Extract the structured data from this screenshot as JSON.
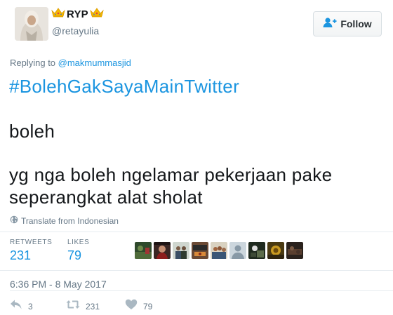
{
  "author": {
    "display_name": "RYP",
    "handle": "@retayulia",
    "avatar_icon": "profile-photo"
  },
  "follow_button": {
    "label": "Follow",
    "icon": "follow-person-icon"
  },
  "replying": {
    "prefix": "Replying to ",
    "mention": "@makmummasjid"
  },
  "tweet": {
    "hashtag": "#BolehGakSayaMainTwitter",
    "line_boleh": "boleh",
    "line_yg": "yg nga boleh ngelamar pekerjaan pake",
    "line_seperangkat": "seperangkat alat sholat"
  },
  "translate": {
    "label": "Translate from Indonesian",
    "icon": "globe-icon"
  },
  "stats": {
    "retweets_label": "RETWEETS",
    "retweets_value": "231",
    "likes_label": "LIKES",
    "likes_value": "79"
  },
  "likers_count_shown": 9,
  "timestamp": "6:36 PM - 8 May 2017",
  "actions": {
    "reply_count": "3",
    "retweet_count": "231",
    "like_count": "79"
  },
  "colors": {
    "link": "#1b95e0",
    "muted": "#657786",
    "text": "#14171a",
    "crown": "#f5b800"
  }
}
